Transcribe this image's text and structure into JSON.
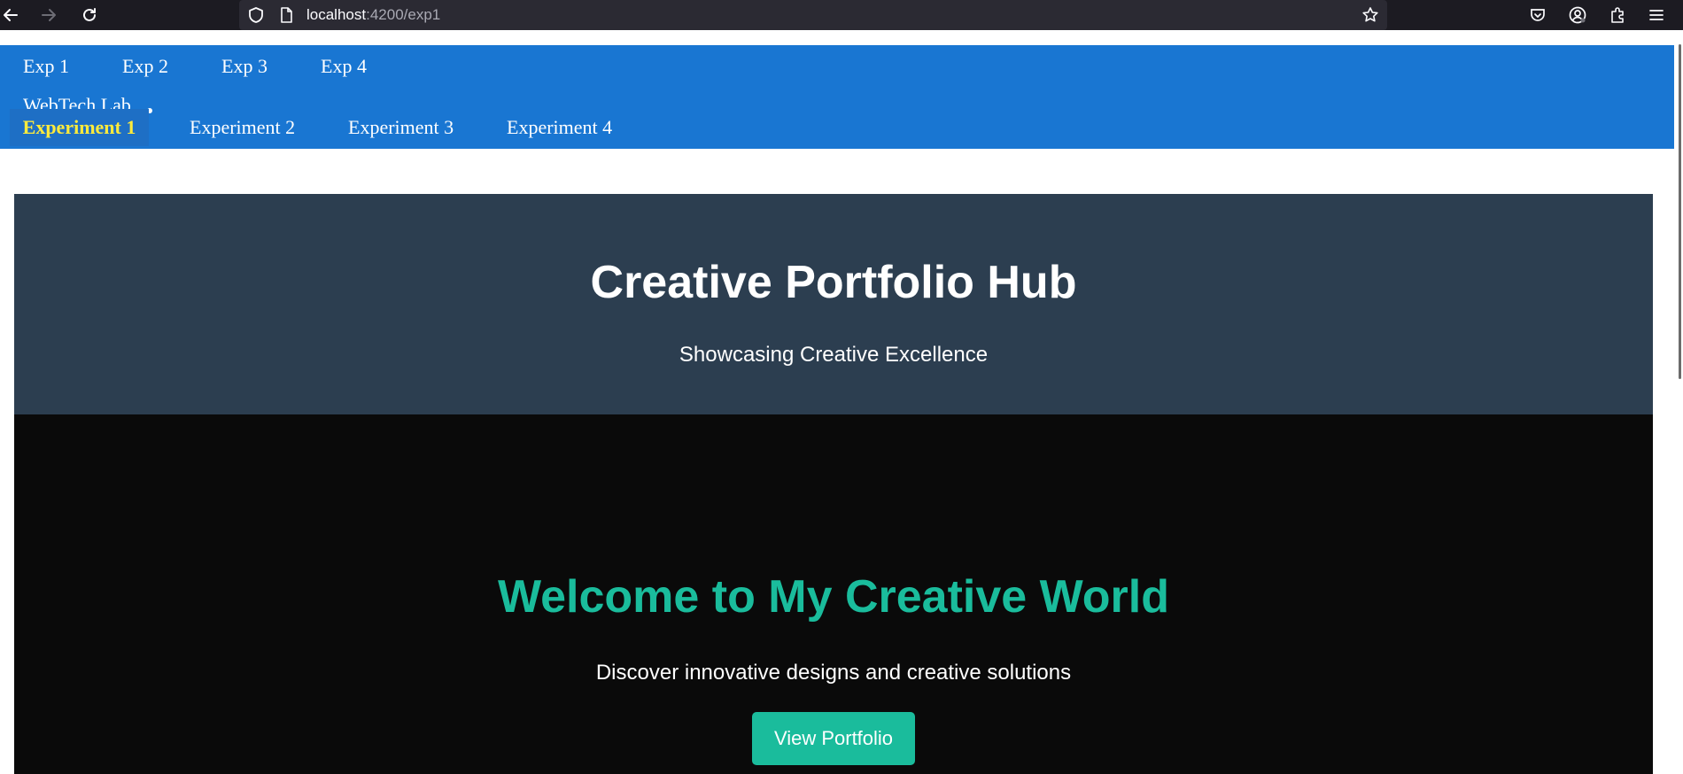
{
  "browser": {
    "url_host": "localhost",
    "url_rest": ":4200/exp1"
  },
  "nav": {
    "top_links": [
      "Exp 1",
      "Exp 2",
      "Exp 3",
      "Exp 4"
    ],
    "brand": "WebTech Lab",
    "sub_links": [
      "Experiment 1",
      "Experiment 2",
      "Experiment 3",
      "Experiment 4"
    ],
    "active_sub": "Experiment 1"
  },
  "header": {
    "title": "Creative Portfolio Hub",
    "subtitle": "Showcasing Creative Excellence"
  },
  "hero": {
    "heading": "Welcome to My Creative World",
    "text": "Discover innovative designs and creative solutions",
    "button_label": "View Portfolio"
  },
  "colors": {
    "nav_bg": "#1976d2",
    "active_link": "#ffeb3b",
    "header_bg": "#2c3e50",
    "accent": "#1abc9c",
    "dark_bg": "#0a0a0a"
  },
  "icons": [
    "back-arrow-icon",
    "forward-arrow-icon",
    "reload-icon",
    "shield-icon",
    "page-icon",
    "bookmark-star-icon",
    "pocket-icon",
    "account-icon",
    "extensions-icon",
    "menu-icon"
  ]
}
